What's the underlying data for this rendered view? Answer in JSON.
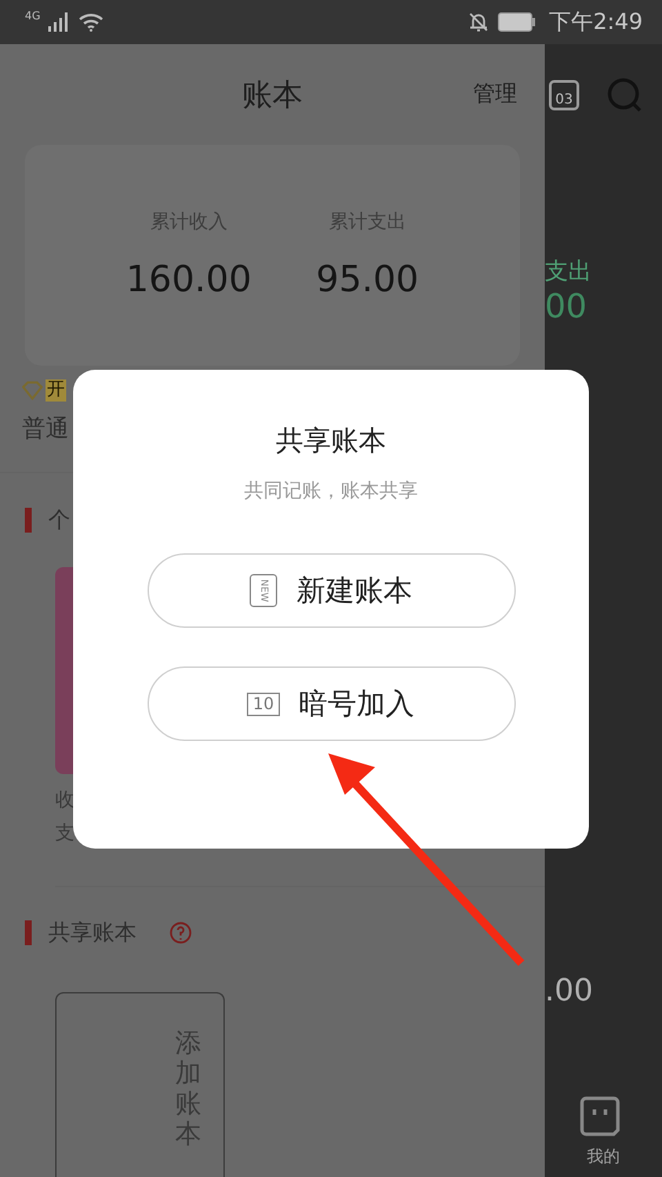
{
  "status_bar": {
    "network": "4G",
    "time": "下午2:49"
  },
  "header": {
    "title": "账本",
    "manage": "管理",
    "calendar_day": "03"
  },
  "summary": {
    "items": [
      {
        "label": "累计收入",
        "value": "160.00"
      },
      {
        "label": "累计支出",
        "value": "95.00"
      }
    ]
  },
  "member": {
    "badge": "开",
    "tier": "普通"
  },
  "personal_section": {
    "title": "个",
    "lines": [
      "收",
      "支"
    ]
  },
  "shared_section": {
    "title": "共享账本",
    "add_label": "添加账本"
  },
  "background_tab": {
    "expense_label": "支出",
    "expense_value": "00",
    "other_value": ".00",
    "nav_label": "我的"
  },
  "dialog": {
    "title": "共享账本",
    "subtitle": "共同记账，账本共享",
    "buttons": [
      {
        "kind": "new",
        "icon_text": "NEW",
        "label": "新建账本"
      },
      {
        "kind": "code",
        "icon_text": "10",
        "label": "暗号加入"
      }
    ]
  }
}
